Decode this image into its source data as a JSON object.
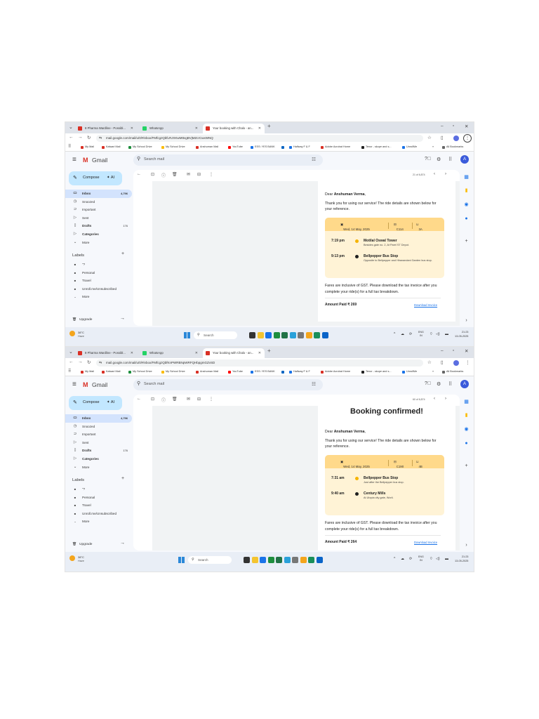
{
  "screenshots": [
    {
      "tabs": [
        {
          "title": "8 Pharma Wardline - Possibl..."
        },
        {
          "title": "WhatsApp"
        },
        {
          "title": "Your booking with Chalo - an..."
        }
      ],
      "url": "mail.google.com/mail/u/0/#inbox/FMfcgzQbfLRJXKwMttvgBVjMZcrCwxWNQ",
      "bookmarks": [
        {
          "label": "My Mail",
          "color": "#d93025"
        },
        {
          "label": "Kalwari Mail",
          "color": "#d93025"
        },
        {
          "label": "My School Drive",
          "color": "#1e8e3e"
        },
        {
          "label": "My School Drive",
          "color": "#fbbc04"
        },
        {
          "label": "Anshuman Mail",
          "color": "#d93025"
        },
        {
          "label": "YouTube",
          "color": "#ff0000"
        },
        {
          "label": "ESS: YES BANK",
          "color": "#1a73e8"
        },
        {
          "label": "",
          "color": "#0a66c2"
        },
        {
          "label": "Halfway F & F",
          "color": "#1a73e8"
        },
        {
          "label": "Adobe Acrobat Home",
          "color": "#d93025"
        },
        {
          "label": "Tenor - skope and s...",
          "color": "#222222"
        },
        {
          "label": "UnrollMe",
          "color": "#1a73e8"
        }
      ],
      "all_bookmarks": "All Bookmarks",
      "app_name": "Gmail",
      "search_placeholder": "Search mail",
      "account_initial": "A",
      "compose": "Compose",
      "ai": "AI",
      "nav": [
        {
          "icon": "inbox-icon",
          "glyph": "▭",
          "label": "Inbox",
          "count": "4,796",
          "active": true
        },
        {
          "icon": "clock-icon",
          "glyph": "◷",
          "label": "Snoozed",
          "count": ""
        },
        {
          "icon": "important-icon",
          "glyph": "⊃",
          "label": "Important",
          "count": ""
        },
        {
          "icon": "send-icon",
          "glyph": "▷",
          "label": "Sent",
          "count": ""
        },
        {
          "icon": "draft-icon",
          "glyph": "▯",
          "label": "Drafts",
          "count": "176",
          "bold": true
        },
        {
          "icon": "categories-icon",
          "glyph": "▷",
          "label": "Categories",
          "count": "",
          "bold": true
        },
        {
          "icon": "chevron-down-icon",
          "glyph": "⌄",
          "label": "More",
          "count": ""
        }
      ],
      "labels_title": "Labels",
      "labels": [
        {
          "glyph": "■",
          "label": "\"?"
        },
        {
          "glyph": "■",
          "label": "Personal"
        },
        {
          "glyph": "■",
          "label": "Travel"
        },
        {
          "glyph": "■",
          "label": "Unroll.me/Unsubscribed"
        },
        {
          "glyph": "⌄",
          "label": "More"
        }
      ],
      "upgrade": "Upgrade",
      "pager": "21 of 6,874",
      "email": {
        "heading": "",
        "greeting_prefix": "Dear ",
        "greeting_name": "Anshuman Verma",
        "greeting_suffix": ",",
        "thanks": "Thank you for using our service! The ride details are shown below for your reference.",
        "date": "Wed, 14 May, 2025",
        "bus": "C114",
        "seat": "3A",
        "stops": [
          {
            "time": "7:19 pm",
            "name": "Motilal Oswal Tower",
            "desc": "Besides gate no. 2, At Parel ST Depot.",
            "color": "#f5b400"
          },
          {
            "time": "9:13 pm",
            "name": "Bellpepper Bus Stop",
            "desc": "Opposite to Bellpepper and Hiranandani Garden bus stop.",
            "color": "#1f1f1f"
          }
        ],
        "fares": "Fares are inclusive of GST. Please download the tax invoice after you complete your ride(s) for a full tax breakdown.",
        "amount": "Amount Paid ₹ 269",
        "invoice": "Download Invoice"
      },
      "weather_temp": "38°C",
      "weather_desc": "Haze",
      "taskbar_search": "Search",
      "lang": "ENG",
      "lang_region": "IN",
      "time": "21:23",
      "date": "13-05-2025"
    },
    {
      "tabs": [
        {
          "title": "8 Pharma Wardline - Possibl..."
        },
        {
          "title": "WhatsApp"
        },
        {
          "title": "Your booking with Chalo - an..."
        }
      ],
      "url": "mail.google.com/mail/u/0/#inbox/FMfcgzQbfKnPWRBNpWRFQHbpgmGZvSD",
      "bookmarks": [
        {
          "label": "My Mail",
          "color": "#d93025"
        },
        {
          "label": "Kalwari Mail",
          "color": "#d93025"
        },
        {
          "label": "My School Drive",
          "color": "#1e8e3e"
        },
        {
          "label": "My School Drive",
          "color": "#fbbc04"
        },
        {
          "label": "Anshuman Mail",
          "color": "#d93025"
        },
        {
          "label": "YouTube",
          "color": "#ff0000"
        },
        {
          "label": "ESS: YES BANK",
          "color": "#1a73e8"
        },
        {
          "label": "",
          "color": "#0a66c2"
        },
        {
          "label": "Halfway F & F",
          "color": "#1a73e8"
        },
        {
          "label": "Adobe Acrobat Home",
          "color": "#d93025"
        },
        {
          "label": "Tenor - skope and s...",
          "color": "#222222"
        },
        {
          "label": "UnrollMe",
          "color": "#1a73e8"
        }
      ],
      "all_bookmarks": "All Bookmarks",
      "app_name": "Gmail",
      "search_placeholder": "Search mail",
      "account_initial": "A",
      "compose": "Compose",
      "ai": "AI",
      "nav": [
        {
          "icon": "inbox-icon",
          "glyph": "▭",
          "label": "Inbox",
          "count": "4,796",
          "active": true
        },
        {
          "icon": "clock-icon",
          "glyph": "◷",
          "label": "Snoozed",
          "count": ""
        },
        {
          "icon": "important-icon",
          "glyph": "⊃",
          "label": "Important",
          "count": ""
        },
        {
          "icon": "send-icon",
          "glyph": "▷",
          "label": "Sent",
          "count": ""
        },
        {
          "icon": "draft-icon",
          "glyph": "▯",
          "label": "Drafts",
          "count": "176",
          "bold": true
        },
        {
          "icon": "categories-icon",
          "glyph": "▷",
          "label": "Categories",
          "count": "",
          "bold": true
        },
        {
          "icon": "chevron-down-icon",
          "glyph": "⌄",
          "label": "More",
          "count": ""
        }
      ],
      "labels_title": "Labels",
      "labels": [
        {
          "glyph": "■",
          "label": "\"?"
        },
        {
          "glyph": "■",
          "label": "Personal"
        },
        {
          "glyph": "■",
          "label": "Travel"
        },
        {
          "glyph": "■",
          "label": "Unroll.me/Unsubscribed"
        },
        {
          "glyph": "⌄",
          "label": "More"
        }
      ],
      "upgrade": "Upgrade",
      "pager": "60 of 6,874",
      "email": {
        "heading": "Booking confirmed!",
        "greeting_prefix": "Dear ",
        "greeting_name": "Anshuman Verma",
        "greeting_suffix": ",",
        "thanks": "Thank you for using our service! The ride details are shown below for your reference.",
        "date": "Wed, 14 May, 2025",
        "bus": "C190",
        "seat": "4B",
        "stops": [
          {
            "time": "7:31 am",
            "name": "Bellpepper Bus Stop",
            "desc": "Just after the Bellpepper bus stop.",
            "color": "#f5b400"
          },
          {
            "time": "9:40 am",
            "name": "Century Mills",
            "desc": "At Utopia city gate, Worli.",
            "color": "#1f1f1f"
          }
        ],
        "fares": "Fares are inclusive of GST. Please download the tax invoice after you complete your ride(s) for a full tax breakdown.",
        "amount": "Amount Paid ₹ 264",
        "invoice": "Download Invoice"
      },
      "weather_temp": "38°C",
      "weather_desc": "Haze",
      "taskbar_search": "Search",
      "lang": "ENG",
      "lang_region": "IN",
      "time": "21:23",
      "date": "13-05-2025"
    }
  ]
}
